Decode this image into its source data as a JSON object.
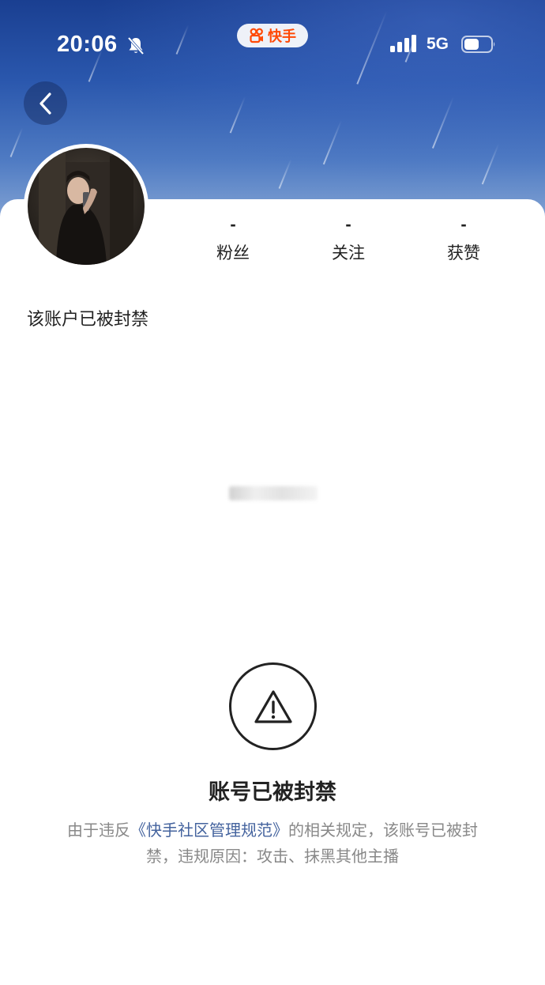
{
  "status_bar": {
    "time": "20:06",
    "network": "5G",
    "app_badge": "快手"
  },
  "nav": {
    "back_icon": "chevron-left-icon"
  },
  "profile": {
    "stats": [
      {
        "value": "-",
        "label": "粉丝"
      },
      {
        "value": "-",
        "label": "关注"
      },
      {
        "value": "-",
        "label": "获赞"
      }
    ],
    "status_line": "该账户已被封禁"
  },
  "ban_notice": {
    "icon": "warning-icon",
    "title": "账号已被封禁",
    "desc_prefix": "由于违反",
    "policy_link": "《快手社区管理规范》",
    "desc_suffix": "的相关规定，该账号已被封禁，违规原因：攻击、抹黑其他主播"
  },
  "colors": {
    "brand": "#ff4906",
    "link": "#44639e",
    "banner_top": "#1a3f91"
  }
}
